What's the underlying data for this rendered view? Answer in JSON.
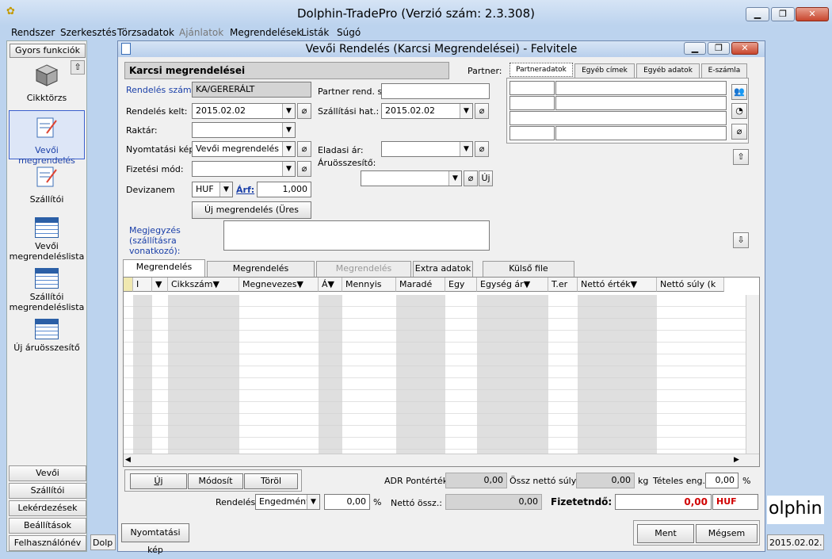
{
  "app": {
    "title": "Dolphin-TradePro  (Verzió szám: 2.3.308)"
  },
  "menu": [
    "Rendszer",
    "Szerkesztés",
    "Törzsadatok",
    "Ajánlatok",
    "Megrendelések",
    "Listák",
    "Súgó"
  ],
  "sidebar": {
    "gyors": "Gyors funkciók",
    "items": [
      {
        "label": "Cikktörzs",
        "icon": "cube-icon"
      },
      {
        "label": "Vevői megrendelés",
        "icon": "order-edit-icon"
      },
      {
        "label": "Szállítói",
        "icon": "order-edit-icon"
      },
      {
        "label": "Vevői megrendeléslista",
        "icon": "grid-list-icon"
      },
      {
        "label": "Szállítói megrendeléslista",
        "icon": "grid-list-icon"
      },
      {
        "label": "Új áruösszesítő",
        "icon": "grid-list-icon"
      }
    ],
    "bottom_tabs": [
      "Vevői megrendelése",
      "Szállítói megrendelés",
      "Lekérdezések",
      "Beállítások",
      "Felhasználónév"
    ],
    "status_left": "Dolp"
  },
  "window": {
    "title": "Vevői Rendelés (Karcsi Megrendelései) - Felvitele",
    "header_name": "Karcsi megrendelései",
    "partner_label": "Partner:",
    "partner_tabs": [
      "Partneradatok",
      "Egyéb címek",
      "Egyéb adatok",
      "E-számla"
    ]
  },
  "form": {
    "rendeles_szama_label": "Rendelés száma:",
    "rendeles_szama": "KA/GERERÁLT",
    "rendeles_kelt_label": "Rendelés kelt:",
    "rendeles_kelt": "2015.02.02",
    "raktar_label": "Raktár:",
    "nyomtatasi_kep_label": "Nyomtatási kép",
    "nyomtatasi_kep": "Vevői megrendelés",
    "fizetesi_mod_label": "Fizetési mód:",
    "devizanem_label": "Devizanem",
    "devizanem": "HUF",
    "arf_label": "Árf:",
    "arf": "1,000",
    "status_button": "Új megrendelés (Üres státusz)",
    "partner_rend_label": "Partner rend. sz",
    "szallitasi_hat_label": "Szállítási hat.:",
    "szallitasi_hat": "2015.02.02",
    "eladasi_ar_label": "Eladasi ár:",
    "aruosszesito_label": "Áruösszesítő:",
    "uj_label": "Új",
    "megjegyzes_label": "Megjegyzés (szállításra vonatkozó):"
  },
  "tabs": [
    "Megrendelés tételei",
    "Megrendelés egyébadatai",
    "Megrendelés státusza",
    "Extra adatok",
    "Külső file feldolgozás"
  ],
  "grid": {
    "columns": [
      "I",
      "",
      "Cikkszám",
      "Megnevezes",
      "Á",
      "Mennyis",
      "Maradé",
      "Egy",
      "Egység ár",
      "T.er",
      "Nettó érték",
      "Nettó súly (k"
    ]
  },
  "bottom": {
    "uj": "Új",
    "modosit": "Módosít",
    "torol": "Töröl",
    "adr_label": "ADR Pontérték:",
    "adr_value": "0,00",
    "ossz_suly_label": "Össz nettó súly:",
    "ossz_suly_value": "0,00",
    "kg": "kg",
    "teteles_label": "Tételes eng.:",
    "teteles_value": "0,00",
    "pct": "%",
    "rendeles_label": "Rendelés",
    "engedmeny": "Engedmény",
    "engedmeny_value": "0,00",
    "netto_ossz_label": "Nettó össz.:",
    "netto_ossz_value": "0,00",
    "fizetendo_label": "Fizetetndő:",
    "fizetendo_value": "0,00",
    "currency": "HUF",
    "nyomtatasi_kep": "Nyomtatási kép",
    "ment": "Ment",
    "megsem": "Mégsem"
  },
  "brand": {
    "logo_text": "olphin",
    "date": "2015.02.02."
  },
  "colors": {
    "accent_blue": "#1a3fa8",
    "red": "#d00000"
  }
}
